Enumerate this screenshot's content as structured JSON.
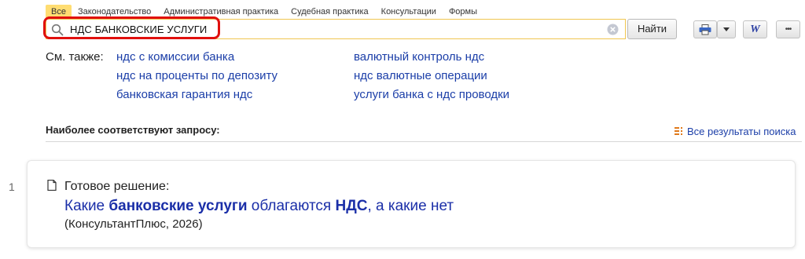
{
  "tabs": [
    {
      "label": "Все",
      "active": true
    },
    {
      "label": "Законодательство"
    },
    {
      "label": "Административная практика"
    },
    {
      "label": "Судебная практика"
    },
    {
      "label": "Консультации"
    },
    {
      "label": "Формы"
    }
  ],
  "search": {
    "query": "НДС БАНКОВСКИЕ УСЛУГИ",
    "find_label": "Найти"
  },
  "toolbar": {
    "word_label": "W",
    "more_label": "•••"
  },
  "see_also": {
    "label": "См. также:",
    "links": [
      "ндс с комиссии банка",
      "ндс на проценты по депозиту",
      "банковская гарантия ндс",
      "валютный контроль ндс",
      "ндс валютные операции",
      "услуги банка с ндс проводки"
    ]
  },
  "results_header": {
    "title": "Наиболее соответствуют запросу:",
    "all_results": "Все результаты поиска"
  },
  "result": {
    "number": "1",
    "type": "Готовое решение:",
    "title_parts": [
      "Какие ",
      "банковские услуги",
      " облагаются ",
      "НДС",
      ", а какие нет"
    ],
    "source": "(КонсультантПлюс, 2026)"
  },
  "colors": {
    "accent": "#ffdd72",
    "link": "#1b3ea8",
    "highlight": "#e0100e"
  }
}
